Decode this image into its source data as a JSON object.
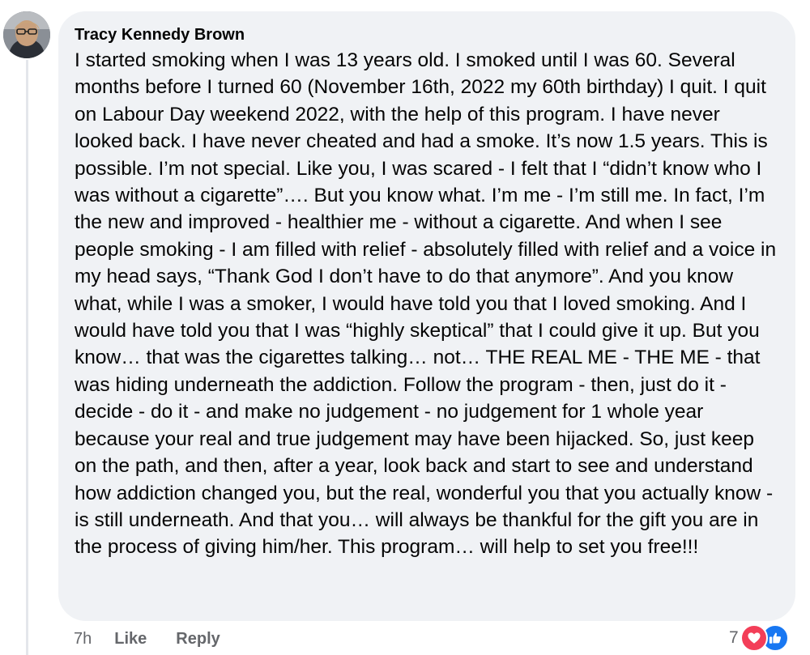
{
  "comment": {
    "author": "Tracy Kennedy Brown",
    "text": "I started smoking when I was 13 years old. I smoked until I was 60. Several months before I turned 60 (November 16th, 2022 my 60th birthday) I quit. I quit on Labour Day weekend 2022, with the help of this program. I have never looked back. I have never cheated and had a smoke. It’s now 1.5 years. This is possible. I’m not special. Like you, I was scared - I felt that I “didn’t know who I was without a cigarette”…. But you know what. I’m me - I’m still me. In fact, I’m the new and improved - healthier me - without a cigarette. And when I see people smoking - I am filled with relief - absolutely filled with relief and a voice in my head says, “Thank God I don’t have to do that anymore”. And you know what, while I was a smoker, I would have told you that I loved smoking. And I would have told you that I was “highly skeptical” that I could give it up. But you know… that was the cigarettes talking… not… THE REAL ME - THE ME - that was hiding underneath the addiction. Follow the program - then, just do it - decide - do it - and make no judgement - no judgement for 1 whole year because your real and true judgement may have been hijacked. So, just keep on the path, and then, after a year, look back and start to see and understand how addiction changed you, but the real, wonderful you that you actually know - is still underneath. And that you… will always be thankful for the gift you are in the process of giving him/her. This program… will help to set you free!!!"
  },
  "actions": {
    "timestamp": "7h",
    "like_label": "Like",
    "reply_label": "Reply"
  },
  "reactions": {
    "count": "7",
    "types": [
      "love-icon",
      "like-icon"
    ]
  },
  "colors": {
    "bubble_bg": "#f0f2f5",
    "secondary_text": "#65676b",
    "love": "#f33e58",
    "like": "#1877f2"
  }
}
